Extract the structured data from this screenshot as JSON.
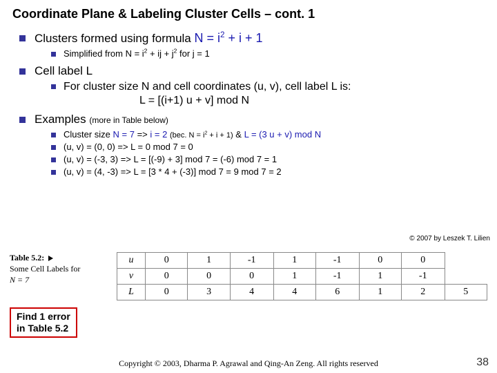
{
  "title": "Coordinate Plane & Labeling Cluster Cells – cont. 1",
  "b1": {
    "prefix": "Clusters formed using formula ",
    "formula_html": "N = i<sup>2</sup> + i + 1",
    "sub_html": "Simplified from N = i<sup>2</sup> + ij + j<sup>2</sup> for j = 1"
  },
  "b2": {
    "head": "Cell label L",
    "sub_line1": "For cluster size N  and cell coordinates (u, v), cell label L is:",
    "formula": "L = [(i+1) u + v] mod N"
  },
  "b3": {
    "head": "Examples ",
    "more": "(more in Table below)",
    "items": [
      {
        "html": "Cluster size <span class='blue'>N = 7</span> =&gt; <span class='blue'>i = 2</span> <span class='xsmall'>(bec. N = i<sup>2</sup> + i + 1)</span> &amp; <span class='blue'>L = (3 u + v) mod N</span>"
      },
      {
        "html": "(u, v) = (0, 0) =&gt; L = 0 mod 7 = 0"
      },
      {
        "html": "(u, v) = (-3, 3) =&gt; L = [(-9) + 3] mod 7 = (-6) mod 7 = 1"
      },
      {
        "html": "(u, v) = (4, -3) =&gt; L = [3 * 4 + (-3)] mod 7 = 9 mod 7 = 2"
      }
    ]
  },
  "copyright_small": "© 2007 by Leszek T. Lilien",
  "chart_data": {
    "type": "table",
    "title": "Table 5.2: Some Cell Labels for N = 7",
    "table_num": "Table 5.2:",
    "table_caption1": "Some Cell Labels for",
    "table_caption2": "N = 7",
    "rows": [
      {
        "label": "u",
        "vals": [
          "0",
          "1",
          "-1",
          "1",
          "-1",
          "0",
          "0"
        ]
      },
      {
        "label": "v",
        "vals": [
          "0",
          "0",
          "0",
          "1",
          "-1",
          "1",
          "-1"
        ]
      },
      {
        "label": "L",
        "vals": [
          "0",
          "3",
          "4",
          "4",
          "6",
          "1",
          "2",
          "5"
        ]
      }
    ]
  },
  "error_box": "Find 1 error\nin Table 5.2",
  "footer": "Copyright © 2003, Dharma P. Agrawal and Qing-An Zeng. All rights reserved",
  "page": "38"
}
